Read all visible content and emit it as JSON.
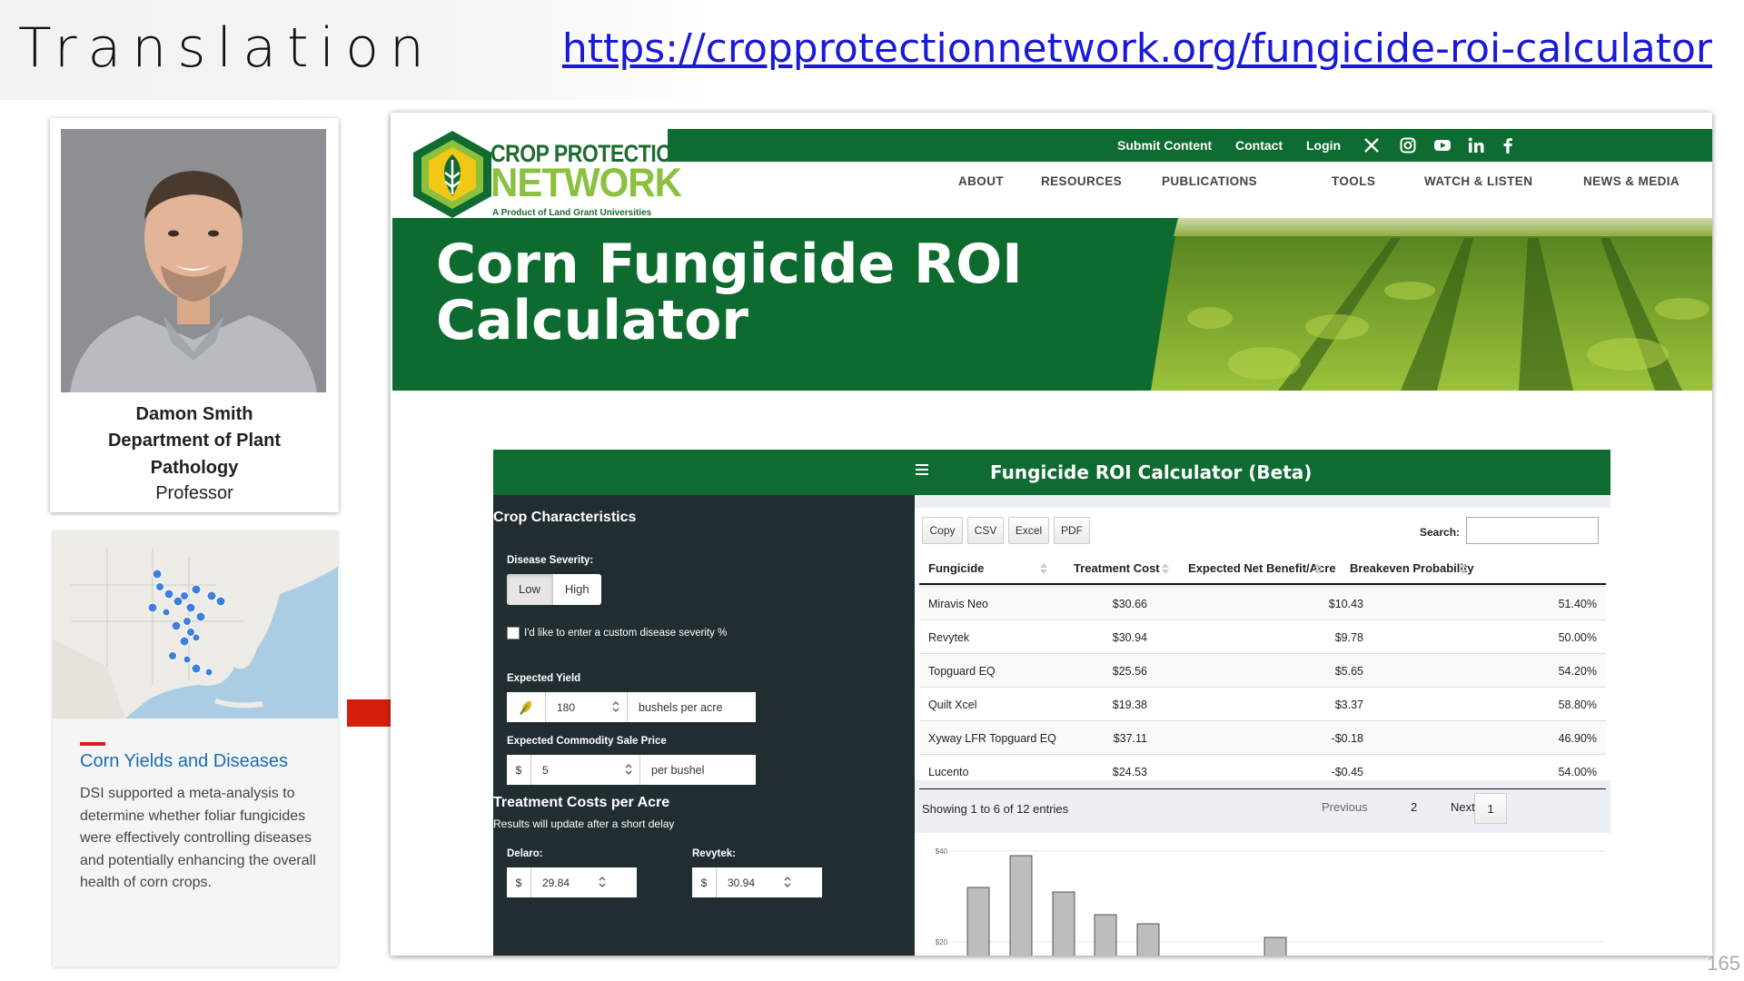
{
  "slide": {
    "title": "Translation",
    "url": "https://cropprotectionnetwork.org/fungicide-roi-calculator",
    "page_number": "165"
  },
  "profile": {
    "name": "Damon Smith",
    "department": "Department of Plant Pathology",
    "role": "Professor"
  },
  "article": {
    "title": "Corn Yields and Diseases",
    "body": "DSI supported a meta-analysis to determine whether foliar fungicides were effectively controlling diseases and potentially enhancing the overall health of corn crops."
  },
  "site": {
    "logo": {
      "line1": "CROP PROTECTION",
      "line2": "NETWORK",
      "line3": "A Product of Land Grant Universities"
    },
    "top_links": [
      "Submit Content",
      "Contact",
      "Login"
    ],
    "social_icons": [
      "x-icon",
      "instagram-icon",
      "youtube-icon",
      "linkedin-icon",
      "facebook-icon"
    ],
    "nav": [
      "ABOUT",
      "RESOURCES",
      "PUBLICATIONS",
      "TOOLS",
      "WATCH & LISTEN",
      "NEWS & MEDIA"
    ],
    "hero_line1": "Corn Fungicide ROI",
    "hero_line2": "Calculator",
    "brand_green": "#0e6b31",
    "accent_lime": "#8bc13f"
  },
  "app": {
    "title": "Fungicide ROI Calculator (Beta)",
    "sidebar": {
      "crop_heading": "Crop Characteristics",
      "severity_label": "Disease Severity:",
      "severity_options": [
        "Low",
        "High"
      ],
      "severity_selected": "Low",
      "custom_severity_label": "I'd like to enter a custom disease severity %",
      "yield_label": "Expected Yield",
      "yield_value": "180",
      "yield_unit": "bushels per acre",
      "price_label": "Expected Commodity Sale Price",
      "price_prefix": "$",
      "price_value": "5",
      "price_unit": "per bushel",
      "costs_heading": "Treatment Costs per Acre",
      "costs_note": "Results will update after a short delay",
      "delaro_label": "Delaro:",
      "delaro_value": "29.84",
      "revytek_label": "Revytek:",
      "revytek_value": "30.94"
    },
    "buttons": [
      "Copy",
      "CSV",
      "Excel",
      "PDF"
    ],
    "search_label": "Search:",
    "table": {
      "headers": [
        "Fungicide",
        "Treatment Cost",
        "Expected Net Benefit/Acre",
        "Breakeven Probability"
      ],
      "rows": [
        [
          "Miravis Neo",
          "$30.66",
          "$10.43",
          "51.40%"
        ],
        [
          "Revytek",
          "$30.94",
          "$9.78",
          "50.00%"
        ],
        [
          "Topguard EQ",
          "$25.56",
          "$5.65",
          "54.20%"
        ],
        [
          "Quilt Xcel",
          "$19.38",
          "$3.37",
          "58.80%"
        ],
        [
          "Xyway LFR Topguard EQ",
          "$37.11",
          "-$0.18",
          "46.90%"
        ],
        [
          "Lucento",
          "$24.53",
          "-$0.45",
          "54.00%"
        ]
      ]
    },
    "showing": "Showing 1 to 6 of 12 entries",
    "pagination": {
      "previous": "Previous",
      "page1": "1",
      "page2": "2",
      "next": "Next"
    }
  },
  "chart_data": {
    "type": "bar",
    "tick_labels": [
      "$40",
      "$20"
    ],
    "ylim": [
      20,
      40
    ],
    "values": [
      32,
      39,
      31,
      26,
      24,
      21
    ],
    "grid": true
  }
}
